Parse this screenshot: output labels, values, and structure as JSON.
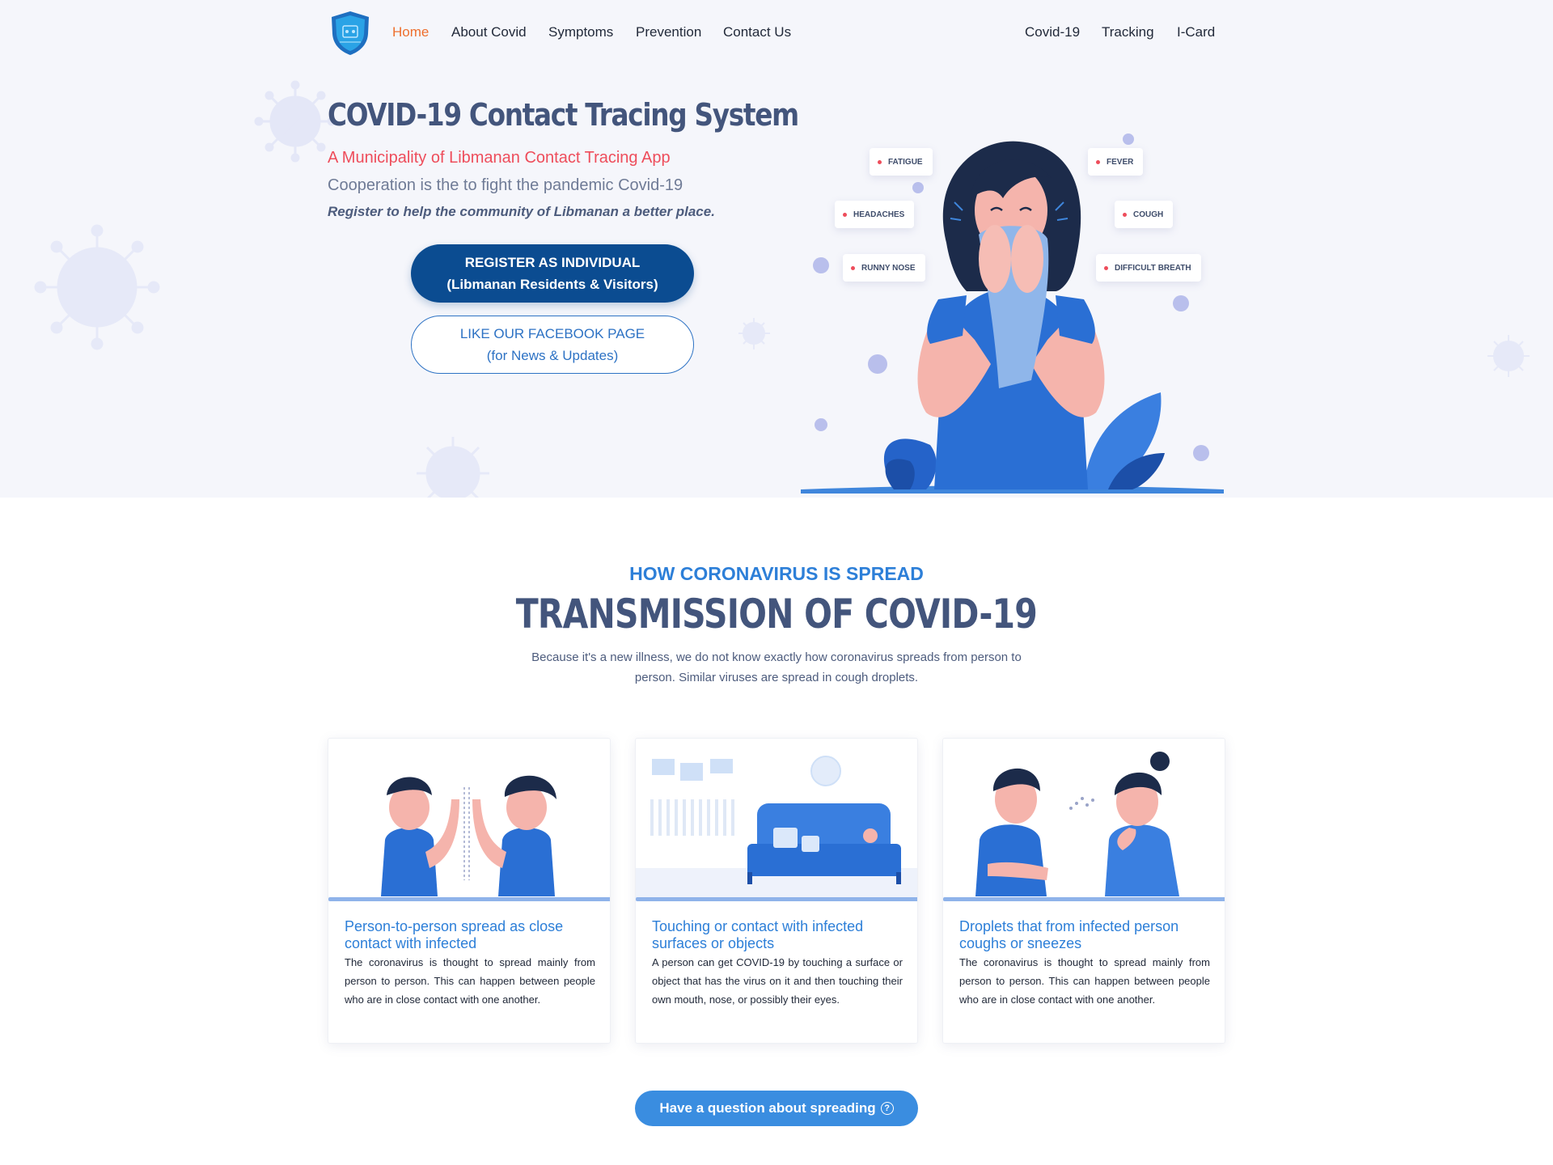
{
  "nav": {
    "links": [
      {
        "label": "Home",
        "active": true
      },
      {
        "label": "About Covid"
      },
      {
        "label": "Symptoms"
      },
      {
        "label": "Prevention"
      },
      {
        "label": "Contact Us"
      }
    ],
    "right_links": [
      {
        "label": "Covid-19"
      },
      {
        "label": "Tracking"
      },
      {
        "label": "I-Card"
      }
    ]
  },
  "hero": {
    "title": "COVID-19 Contact Tracing System",
    "subtitle": "A Municipality of Libmanan Contact Tracing App",
    "cooperation": "Cooperation is the to fight the pandemic Covid-19",
    "register_note": "Register to help the community of Libmanan a better place.",
    "register_button": {
      "line1": "REGISTER AS INDIVIDUAL",
      "line2": "(Libmanan Residents & Visitors)"
    },
    "facebook_button": {
      "line1": "LIKE OUR FACEBOOK PAGE",
      "line2": "(for News & Updates)"
    },
    "symptoms": [
      "FATIGUE",
      "FEVER",
      "HEADACHES",
      "COUGH",
      "RUNNY NOSE",
      "DIFFICULT BREATH"
    ]
  },
  "transmission": {
    "kicker": "HOW CORONAVIRUS IS SPREAD",
    "title": "TRANSMISSION OF COVID-19",
    "description": "Because it's a new illness, we do not know exactly how coronavirus spreads from person to person. Similar viruses are spread in cough droplets.",
    "cards": [
      {
        "title": "Person-to-person spread as close contact with infected",
        "text": "The coronavirus is thought to spread mainly from person to person. This can happen between people who are in close contact with one another."
      },
      {
        "title": "Touching or contact with infected surfaces or objects",
        "text": "A person can get COVID-19 by touching a surface or object that has the virus on it and then touching their own mouth, nose, or possibly their eyes."
      },
      {
        "title": "Droplets that from infected person coughs or sneezes",
        "text": "The coronavirus is thought to spread mainly from person to person. This can happen between people who are in close contact with one another."
      }
    ],
    "question_button": "Have a question about spreading"
  },
  "colors": {
    "accent_orange": "#ee6f2d",
    "heading_navy": "#43557c",
    "subtitle_red": "#ee4d5b",
    "primary_blue": "#2d7fd8",
    "register_button": "#0b4c91"
  },
  "icons": [
    "shield-logo-icon",
    "question-circle-icon"
  ]
}
